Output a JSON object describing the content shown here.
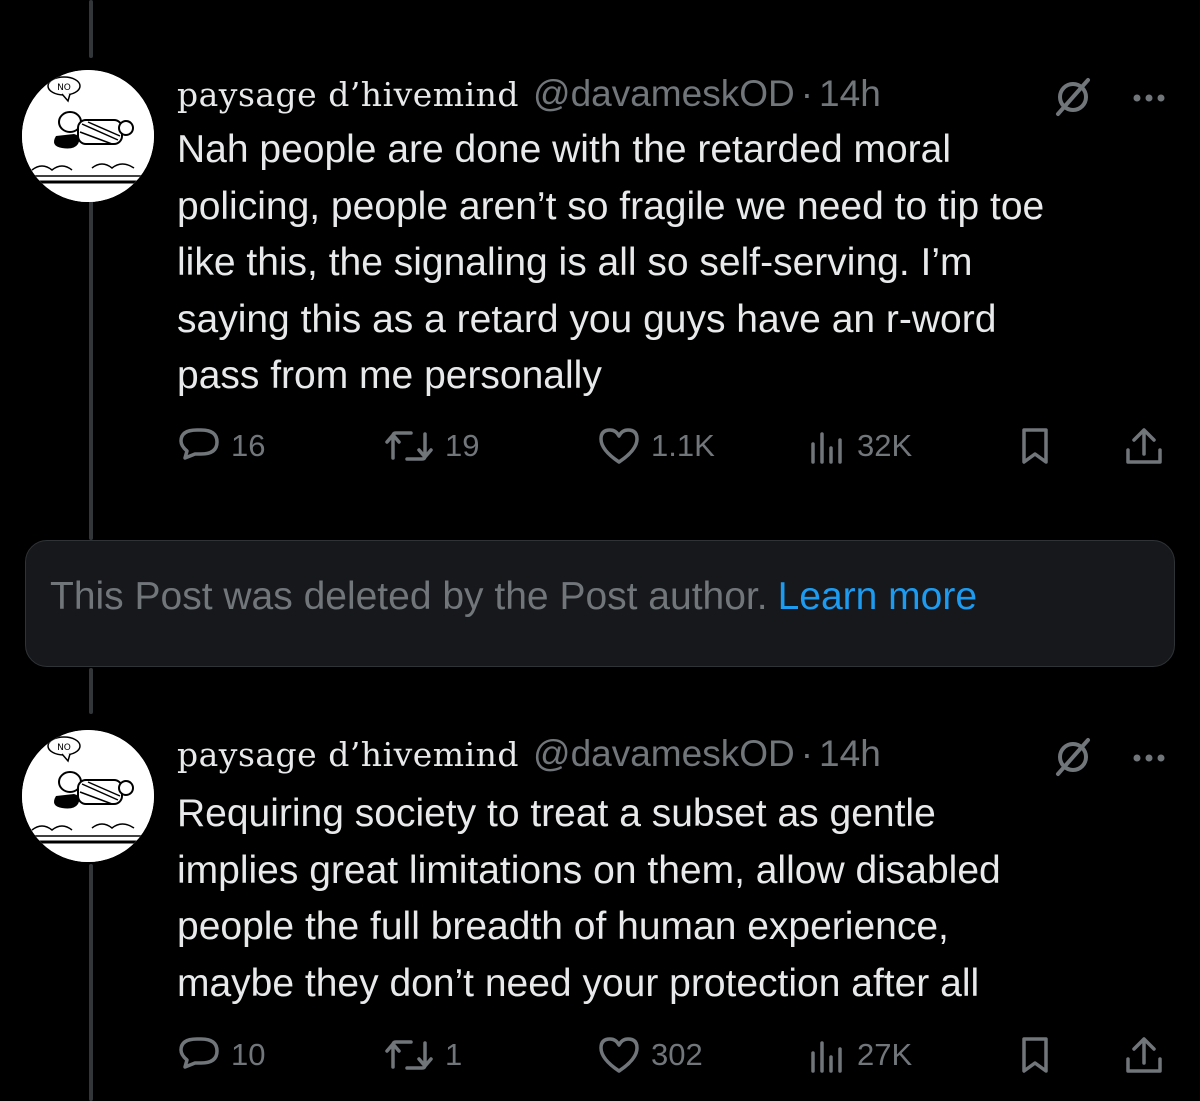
{
  "colors": {
    "background": "#000000",
    "text_primary": "#e7e9ea",
    "text_secondary": "#71767b",
    "link": "#1d9bf0",
    "card_background": "#16181c",
    "thread_line": "#333639"
  },
  "posts": [
    {
      "display_name": "paysage d’hivemind",
      "handle": "@davameskOD",
      "separator": "·",
      "time": "14h",
      "avatar_label": "NO",
      "text_lines": [
        "Nah people are done with the retarded moral",
        "policing, people aren’t so fragile we need to tip toe",
        "like this, the signaling is all so self-serving. I’m",
        "saying this as a retard you guys have an r-word",
        "pass from me personally"
      ],
      "stats": {
        "replies": "16",
        "reposts": "19",
        "likes": "1.1K",
        "views": "32K"
      },
      "icons": {
        "grok": "grok-slash-icon",
        "more": "more-dots-icon",
        "reply": "reply-bubble-icon",
        "repost": "repost-arrows-icon",
        "like": "heart-icon",
        "views": "views-bars-icon",
        "bookmark": "bookmark-icon",
        "share": "share-upload-icon"
      }
    },
    {
      "display_name": "paysage d’hivemind",
      "handle": "@davameskOD",
      "separator": "·",
      "time": "14h",
      "avatar_label": "NO",
      "text_lines": [
        "Requiring society to treat a subset as gentle",
        "implies great limitations on them, allow disabled",
        "people the full breadth of human experience,",
        "maybe they don’t need your protection after all"
      ],
      "stats": {
        "replies": "10",
        "reposts": "1",
        "likes": "302",
        "views": "27K"
      },
      "icons": {
        "grok": "grok-slash-icon",
        "more": "more-dots-icon",
        "reply": "reply-bubble-icon",
        "repost": "repost-arrows-icon",
        "like": "heart-icon",
        "views": "views-bars-icon",
        "bookmark": "bookmark-icon",
        "share": "share-upload-icon"
      }
    }
  ],
  "deleted_notice": {
    "text": "This Post was deleted by the Post author.",
    "link": "Learn more"
  }
}
